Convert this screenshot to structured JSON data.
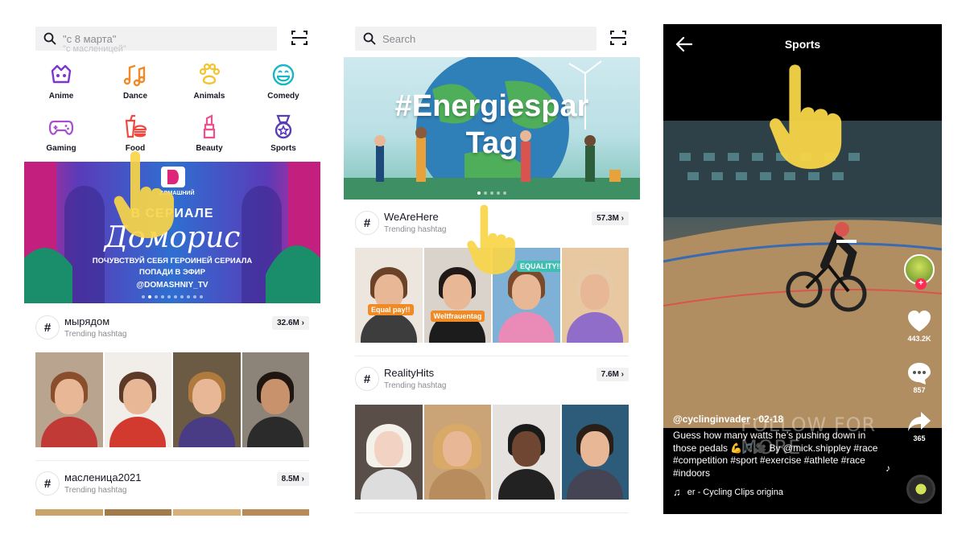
{
  "panel1": {
    "search": {
      "placeholder": "\"с 8 марта\"",
      "secondary": "\"с масленицей\""
    },
    "categories": [
      {
        "label": "Anime",
        "icon": "anime-icon",
        "color": "#7b35d5"
      },
      {
        "label": "Dance",
        "icon": "music-notes-icon",
        "color": "#f08a24"
      },
      {
        "label": "Animals",
        "icon": "paw-icon",
        "color": "#f5c32c"
      },
      {
        "label": "Comedy",
        "icon": "smile-icon",
        "color": "#19b6c6"
      },
      {
        "label": "Gaming",
        "icon": "gamepad-icon",
        "color": "#a94dd1"
      },
      {
        "label": "Food",
        "icon": "burger-drink-icon",
        "color": "#f0483e"
      },
      {
        "label": "Beauty",
        "icon": "lipstick-icon",
        "color": "#ee4f8f"
      },
      {
        "label": "Sports",
        "icon": "medal-icon",
        "color": "#5a3bb8"
      }
    ],
    "banner": {
      "brand": "ДОМАШНИЙ",
      "line1": "В СЕРИАЛЕ",
      "script": "Доморис",
      "line2": "ПОЧУВСТВУЙ СЕБЯ ГЕРОИНЕЙ СЕРИАЛА",
      "line3": "ПОПАДИ В ЭФИР",
      "handle": "@DOMASHNIY_TV",
      "dots": 10,
      "active_dot": 1
    },
    "hashtags": [
      {
        "name": "мырядом",
        "sub": "Trending hashtag",
        "count": "32.6M"
      },
      {
        "name": "масленица2021",
        "sub": "Trending hashtag",
        "count": "8.5M"
      }
    ]
  },
  "panel2": {
    "search": {
      "placeholder": "Search"
    },
    "banner": {
      "line1": "#Energiespar",
      "line2": "Tag",
      "dots": 5,
      "active_dot": 0
    },
    "hashtags": [
      {
        "name": "WeAreHere",
        "sub": "Trending hashtag",
        "count": "57.3M",
        "stickers": [
          "Equal pay!!",
          "Weltfrauentag",
          "EQUALITY!!"
        ]
      },
      {
        "name": "RealityHits",
        "sub": "Trending hashtag",
        "count": "7.6M"
      }
    ]
  },
  "panel3": {
    "title": "Sports",
    "overlay": "FOLLOW FOR MORE",
    "author": "@cyclinginvader · 02-18",
    "caption": "Guess how many watts he’s pushing down in those pedals 💪🎵🎥 By @mick.shippley #race #competition #sport #exercise #athlete #race #indoors",
    "music": "er - Cycling Clips   origina",
    "likes": "443.2K",
    "comments": "857",
    "shares": "365",
    "accent": "#fe2c55"
  },
  "colors": {
    "hand": "#f8d548",
    "tag_bg": "#f1f1f2"
  }
}
